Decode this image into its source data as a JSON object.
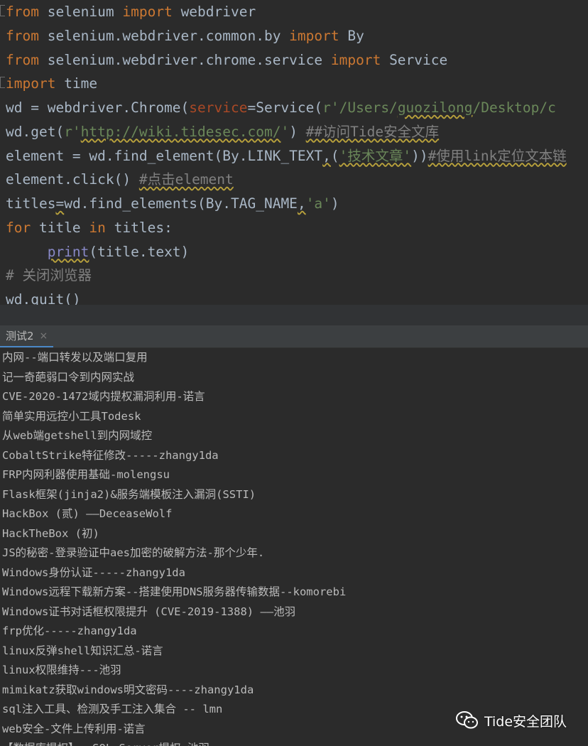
{
  "editor": {
    "lines": [
      [
        {
          "t": "from",
          "c": "kw"
        },
        {
          "t": " selenium "
        },
        {
          "t": "import",
          "c": "kw"
        },
        {
          "t": " webdriver"
        }
      ],
      [
        {
          "t": "from",
          "c": "kw"
        },
        {
          "t": " selenium.webdriver.common.by "
        },
        {
          "t": "import",
          "c": "kw"
        },
        {
          "t": " By"
        }
      ],
      [
        {
          "t": "from",
          "c": "kw"
        },
        {
          "t": " selenium.webdriver.chrome.service "
        },
        {
          "t": "import",
          "c": "kw"
        },
        {
          "t": " Service"
        }
      ],
      [
        {
          "t": "import",
          "c": "kw"
        },
        {
          "t": " time"
        }
      ],
      [
        {
          "t": "wd = webdriver.Chrome("
        },
        {
          "t": "service",
          "c": "param"
        },
        {
          "t": "=Service("
        },
        {
          "t": "r'/Users/",
          "c": "str"
        },
        {
          "t": "guozilong",
          "c": "str wavy"
        },
        {
          "t": "/Desktop/c",
          "c": "str"
        }
      ],
      [
        {
          "t": "wd.get("
        },
        {
          "t": "r'",
          "c": "str"
        },
        {
          "t": "http://wiki.tidesec.com/",
          "c": "str wavy"
        },
        {
          "t": "'",
          "c": "str"
        },
        {
          "t": ") "
        },
        {
          "t": "##访问Tide安全文库",
          "c": "cm wavy"
        }
      ],
      [
        {
          "t": "element = wd.find_element(By.LINK_TEXT"
        },
        {
          "t": ",",
          "c": "wavy"
        },
        {
          "t": "("
        },
        {
          "t": "'技术文章'",
          "c": "str wavy"
        },
        {
          "t": "))"
        },
        {
          "t": "#使用link定位文本链",
          "c": "cm wavy"
        }
      ],
      [
        {
          "t": "element.click() "
        },
        {
          "t": "#点击element",
          "c": "cm wavy"
        }
      ],
      [
        {
          "t": "titles"
        },
        {
          "t": "=",
          "c": "wavy"
        },
        {
          "t": "wd.find_elements(By.TAG_NAME"
        },
        {
          "t": ",",
          "c": "wavy"
        },
        {
          "t": "'a'",
          "c": "str"
        },
        {
          "t": ")"
        }
      ],
      [
        {
          "t": "for",
          "c": "kw"
        },
        {
          "t": " title "
        },
        {
          "t": "in",
          "c": "kw"
        },
        {
          "t": " titles:"
        }
      ],
      [
        {
          "t": "     "
        },
        {
          "t": "print",
          "c": "builtin wavy"
        },
        {
          "t": "(title.text)"
        }
      ],
      [
        {
          "t": "# 关闭浏览器",
          "c": "cm"
        }
      ],
      [
        {
          "t": "wd.quit()"
        }
      ]
    ]
  },
  "run_panel": {
    "tab_label": "测试2",
    "close_symbol": "×"
  },
  "console": {
    "lines": [
      "内网--端口转发以及端口复用",
      "记一奇葩弱口令到内网实战",
      "CVE-2020-1472域内提权漏洞利用-诺言",
      "简单实用远控小工具Todesk",
      "从web端getshell到内网域控",
      "CobaltStrike特征修改-----zhangy1da",
      "FRP内网利器使用基础-molengsu",
      "Flask框架(jinja2)&服务端模板注入漏洞(SSTI)",
      "HackBox (贰) ——DeceaseWolf",
      "HackTheBox (初)",
      "JS的秘密-登录验证中aes加密的破解方法-那个少年.",
      "Windows身份认证-----zhangy1da",
      "Windows远程下载新方案--搭建使用DNS服务器传输数据--komorebi",
      "Windows证书对话框权限提升 (CVE-2019-1388) ——池羽",
      "frp优化-----zhangy1da",
      "linux反弹shell知识汇总-诺言",
      "linux权限维持---池羽",
      "mimikatz获取windows明文密码----zhangy1da",
      "sql注入工具、检测及手工注入集合 -- lmn",
      "web安全-文件上传利用-诺言",
      "【数据库提权】- SQL Server提权-池羽"
    ]
  },
  "watermark": {
    "text": "Tide安全团队"
  }
}
